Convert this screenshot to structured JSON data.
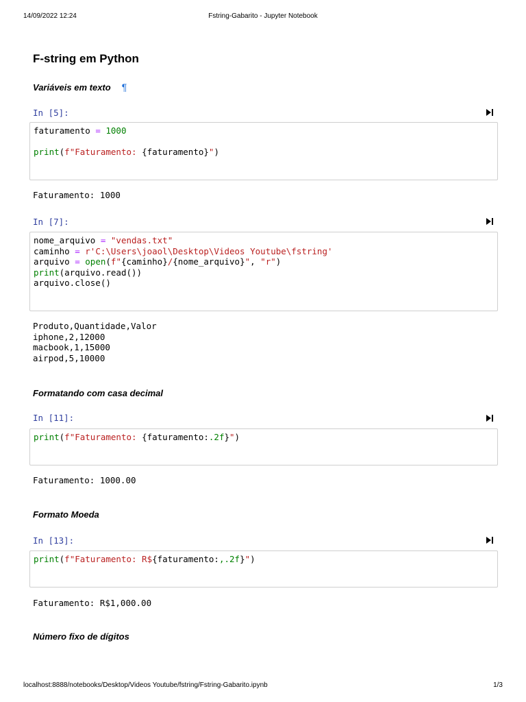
{
  "print_header": {
    "date": "14/09/2022 12:24",
    "title": "Fstring-Gabarito - Jupyter Notebook"
  },
  "print_footer": {
    "url": "localhost:8888/notebooks/Desktop/Videos Youtube/fstring/Fstring-Gabarito.ipynb",
    "page": "1/3"
  },
  "notebook": {
    "title": "F-string em Python",
    "section1": {
      "heading": "Variáveis em texto",
      "anchor": "¶"
    },
    "cell1": {
      "prompt": "In [5]:",
      "line1": {
        "a": "faturamento ",
        "b": "=",
        "c": " ",
        "d": "1000"
      },
      "line2": {
        "a": "print",
        "b": "(",
        "c": "f\"Faturamento: ",
        "d": "{faturamento}",
        "e": "\"",
        "f": ")"
      },
      "output": [
        "Faturamento: 1000"
      ]
    },
    "cell2": {
      "prompt": "In [7]:",
      "line1": {
        "a": "nome_arquivo ",
        "b": "=",
        "c": " ",
        "d": "\"vendas.txt\""
      },
      "line2": {
        "a": "caminho ",
        "b": "=",
        "c": " ",
        "d": "r'C:\\Users\\joaol\\Desktop\\Videos Youtube\\fstring'"
      },
      "line3": {
        "a": "arquivo ",
        "b": "=",
        "c": " ",
        "d": "open",
        "e": "(",
        "f": "f\"",
        "g": "{caminho}",
        "h": "/",
        "i": "{nome_arquivo}",
        "j": "\"",
        "k": ", ",
        "l": "\"r\"",
        "m": ")"
      },
      "line4": {
        "a": "print",
        "b": "(arquivo.read())"
      },
      "line5": {
        "a": "arquivo.close()"
      },
      "output": [
        "Produto,Quantidade,Valor",
        "iphone,2,12000",
        "macbook,1,15000",
        "airpod,5,10000"
      ]
    },
    "section2": {
      "heading": "Formatando com casa decimal"
    },
    "cell3": {
      "prompt": "In [11]:",
      "line1": {
        "a": "print",
        "b": "(",
        "c": "f\"Faturamento: ",
        "d": "{faturamento:",
        "e": ".2f",
        "f": "}",
        "g": "\"",
        "h": ")"
      },
      "output": [
        "Faturamento: 1000.00"
      ]
    },
    "section3": {
      "heading": "Formato Moeda"
    },
    "cell4": {
      "prompt": "In [13]:",
      "line1": {
        "a": "print",
        "b": "(",
        "c": "f\"Faturamento: R$",
        "d": "{faturamento:",
        "e": ",.2f",
        "f": "}",
        "g": "\"",
        "h": ")"
      },
      "output": [
        "Faturamento: R$1,000.00"
      ]
    },
    "section4": {
      "heading": "Número fixo de dígitos"
    }
  },
  "icons": {
    "run": "run-cell-icon"
  },
  "colors": {
    "prompt": "#303f9f",
    "keyword": "#008000",
    "string": "#ba2121",
    "operator": "#aa22ff",
    "anchor": "#1e6fd9"
  }
}
